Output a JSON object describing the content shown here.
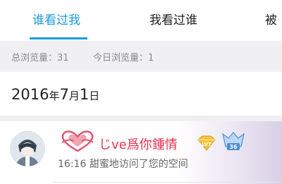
{
  "tabs": [
    {
      "label": "谁看过我",
      "active": true
    },
    {
      "label": "我看过谁",
      "active": false
    },
    {
      "label": "被",
      "active": false
    }
  ],
  "stats": {
    "total": "总浏览量：31",
    "today": "今日浏览量：1"
  },
  "date": {
    "year": "2016",
    "year_unit": "年",
    "month": "7",
    "month_unit": "月",
    "day": "1",
    "day_unit": "日"
  },
  "visits": [
    {
      "nickname": "じve爲你鍾情",
      "time": "16:16",
      "action": "甜蜜地访问了您的空间",
      "badges": {
        "vip": "LV7",
        "level": "36"
      }
    }
  ],
  "colors": {
    "accent": "#1a9be0",
    "nickname": "#e8344e"
  }
}
